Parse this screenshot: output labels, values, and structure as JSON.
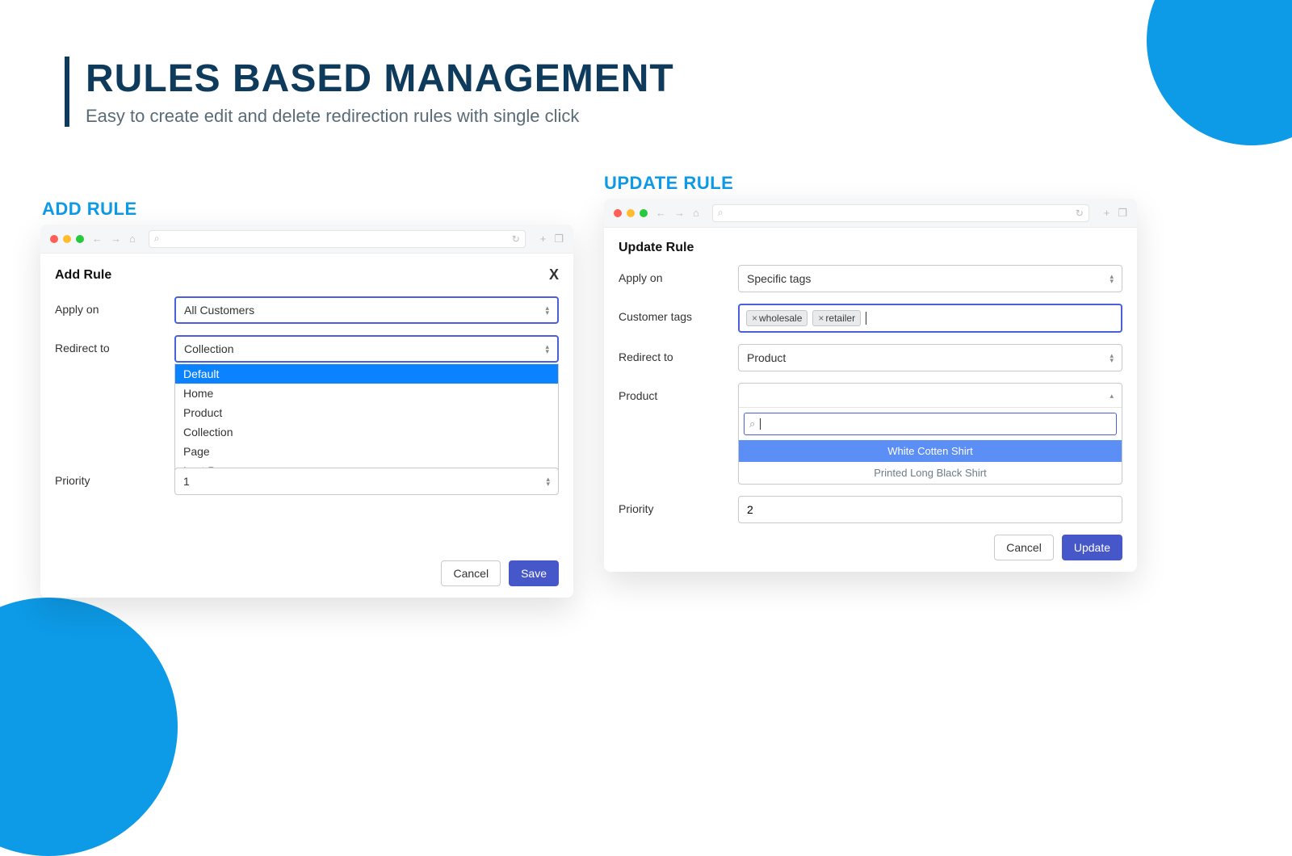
{
  "header": {
    "title": "RULES BASED MANAGEMENT",
    "subtitle": "Easy to create edit and delete redirection rules with single click"
  },
  "sections": {
    "add_label": "ADD RULE",
    "update_label": "UPDATE RULE"
  },
  "add_rule": {
    "title": "Add Rule",
    "labels": {
      "apply_on": "Apply on",
      "redirect_to": "Redirect to",
      "priority": "Priority"
    },
    "apply_on_value": "All Customers",
    "redirect_to_value": "Collection",
    "redirect_options": [
      "Default",
      "Home",
      "Product",
      "Collection",
      "Page",
      "Last Page"
    ],
    "redirect_selected_option": "Default",
    "priority_value": "1",
    "buttons": {
      "cancel": "Cancel",
      "save": "Save"
    }
  },
  "update_rule": {
    "title": "Update Rule",
    "labels": {
      "apply_on": "Apply on",
      "customer_tags": "Customer tags",
      "redirect_to": "Redirect to",
      "product": "Product",
      "priority": "Priority"
    },
    "apply_on_value": "Specific tags",
    "customer_tags": [
      "wholesale",
      "retailer"
    ],
    "redirect_to_value": "Product",
    "product_options": [
      "White Cotten Shirt",
      "Printed Long Black Shirt"
    ],
    "product_highlighted": "White Cotten Shirt",
    "priority_value": "2",
    "buttons": {
      "cancel": "Cancel",
      "update": "Update"
    }
  }
}
